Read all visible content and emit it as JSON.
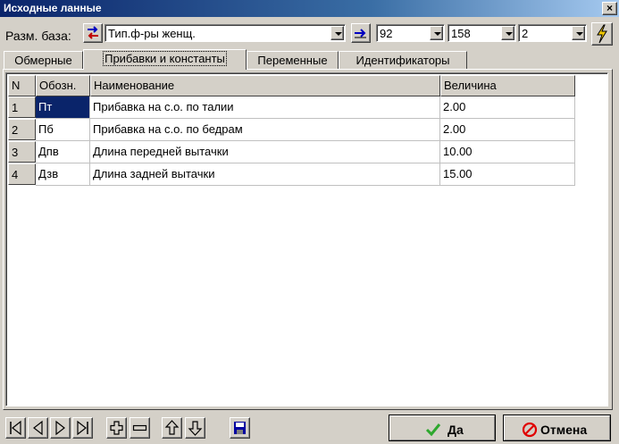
{
  "window": {
    "title": "Исходные ланные",
    "close_glyph": "×"
  },
  "toolbar": {
    "base_label": "Разм. база:",
    "base_value": "Тип.ф-ры женщ.",
    "combo1_value": "92",
    "combo2_value": "158",
    "combo3_value": "2"
  },
  "tabs": [
    {
      "label": "Обмерные",
      "active": false
    },
    {
      "label": "Прибавки и константы",
      "active": true
    },
    {
      "label": "Переменные",
      "active": false
    },
    {
      "label": "Идентификаторы",
      "active": false
    }
  ],
  "table": {
    "headers": [
      "N",
      "Обозн.",
      "Наименование",
      "Величина"
    ],
    "rows": [
      {
        "n": "1",
        "code": "Пт",
        "name": "Прибавка на с.о. по талии",
        "value": "2.00"
      },
      {
        "n": "2",
        "code": "Пб",
        "name": "Прибавка на с.о. по бедрам",
        "value": "2.00"
      },
      {
        "n": "3",
        "code": "Дпв",
        "name": "Длина  передней вытачки",
        "value": "10.00"
      },
      {
        "n": "4",
        "code": "Дзв",
        "name": "Длина задней вытачки",
        "value": "15.00"
      }
    ]
  },
  "buttons": {
    "ok_label": "Да",
    "cancel_label": "Отмена"
  },
  "colors": {
    "selection": "#0a246a",
    "title_start": "#0a246a",
    "ok_check": "#2ea82e",
    "cancel_icon": "#e00000",
    "lightning": "#f0c800"
  },
  "icons": [
    "swap-arrows-icon",
    "apply-arrow-icon",
    "lightning-icon",
    "first-record-icon",
    "prev-record-icon",
    "next-record-icon",
    "last-record-icon",
    "add-icon",
    "remove-icon",
    "move-up-icon",
    "move-down-icon",
    "save-icon",
    "checkmark-icon",
    "cancel-icon"
  ]
}
